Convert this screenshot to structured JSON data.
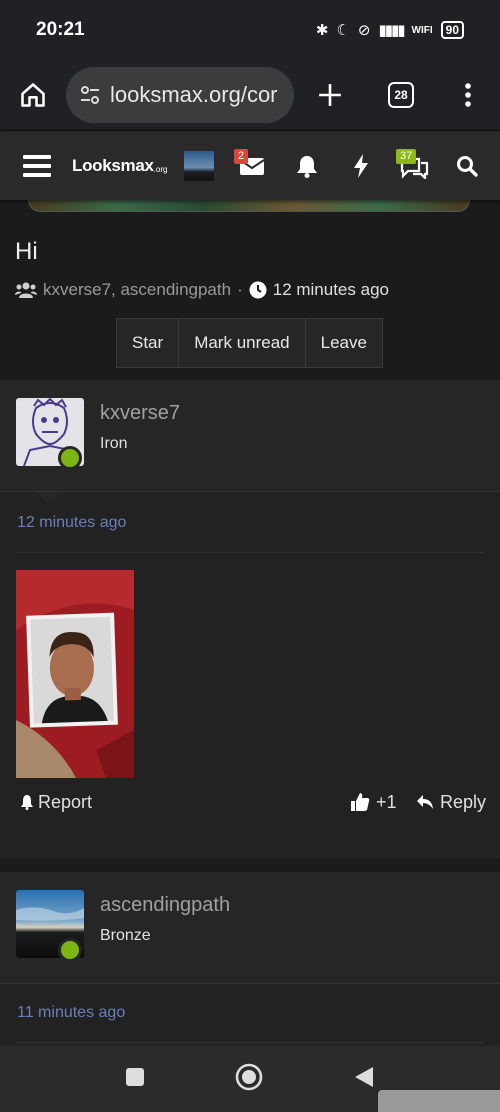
{
  "status_bar": {
    "time": "20:21",
    "battery": "90",
    "wifi_label": "WIFI"
  },
  "browser": {
    "url": "looksmax.org/cor",
    "tab_count": "28"
  },
  "site_nav": {
    "logo_text": "Looksmax",
    "logo_suffix": ".org",
    "inbox_badge": "2",
    "conversations_badge": "37"
  },
  "conversation": {
    "title": "Hi",
    "participants": "kxverse7, ascendingpath",
    "separator": "·",
    "time": "12 minutes ago",
    "actions": [
      "Star",
      "Mark unread",
      "Leave"
    ]
  },
  "messages": [
    {
      "username": "kxverse7",
      "rank": "Iron",
      "time": "12 minutes ago",
      "report": "Report",
      "reactions": "+1",
      "reply": "Reply"
    },
    {
      "username": "ascendingpath",
      "rank": "Bronze",
      "time": "11 minutes ago"
    }
  ],
  "colors": {
    "online": "#7db515",
    "timestamp": "#6b7fb8",
    "inbox_badge": "#d9463a",
    "conv_badge": "#8cb81a"
  }
}
